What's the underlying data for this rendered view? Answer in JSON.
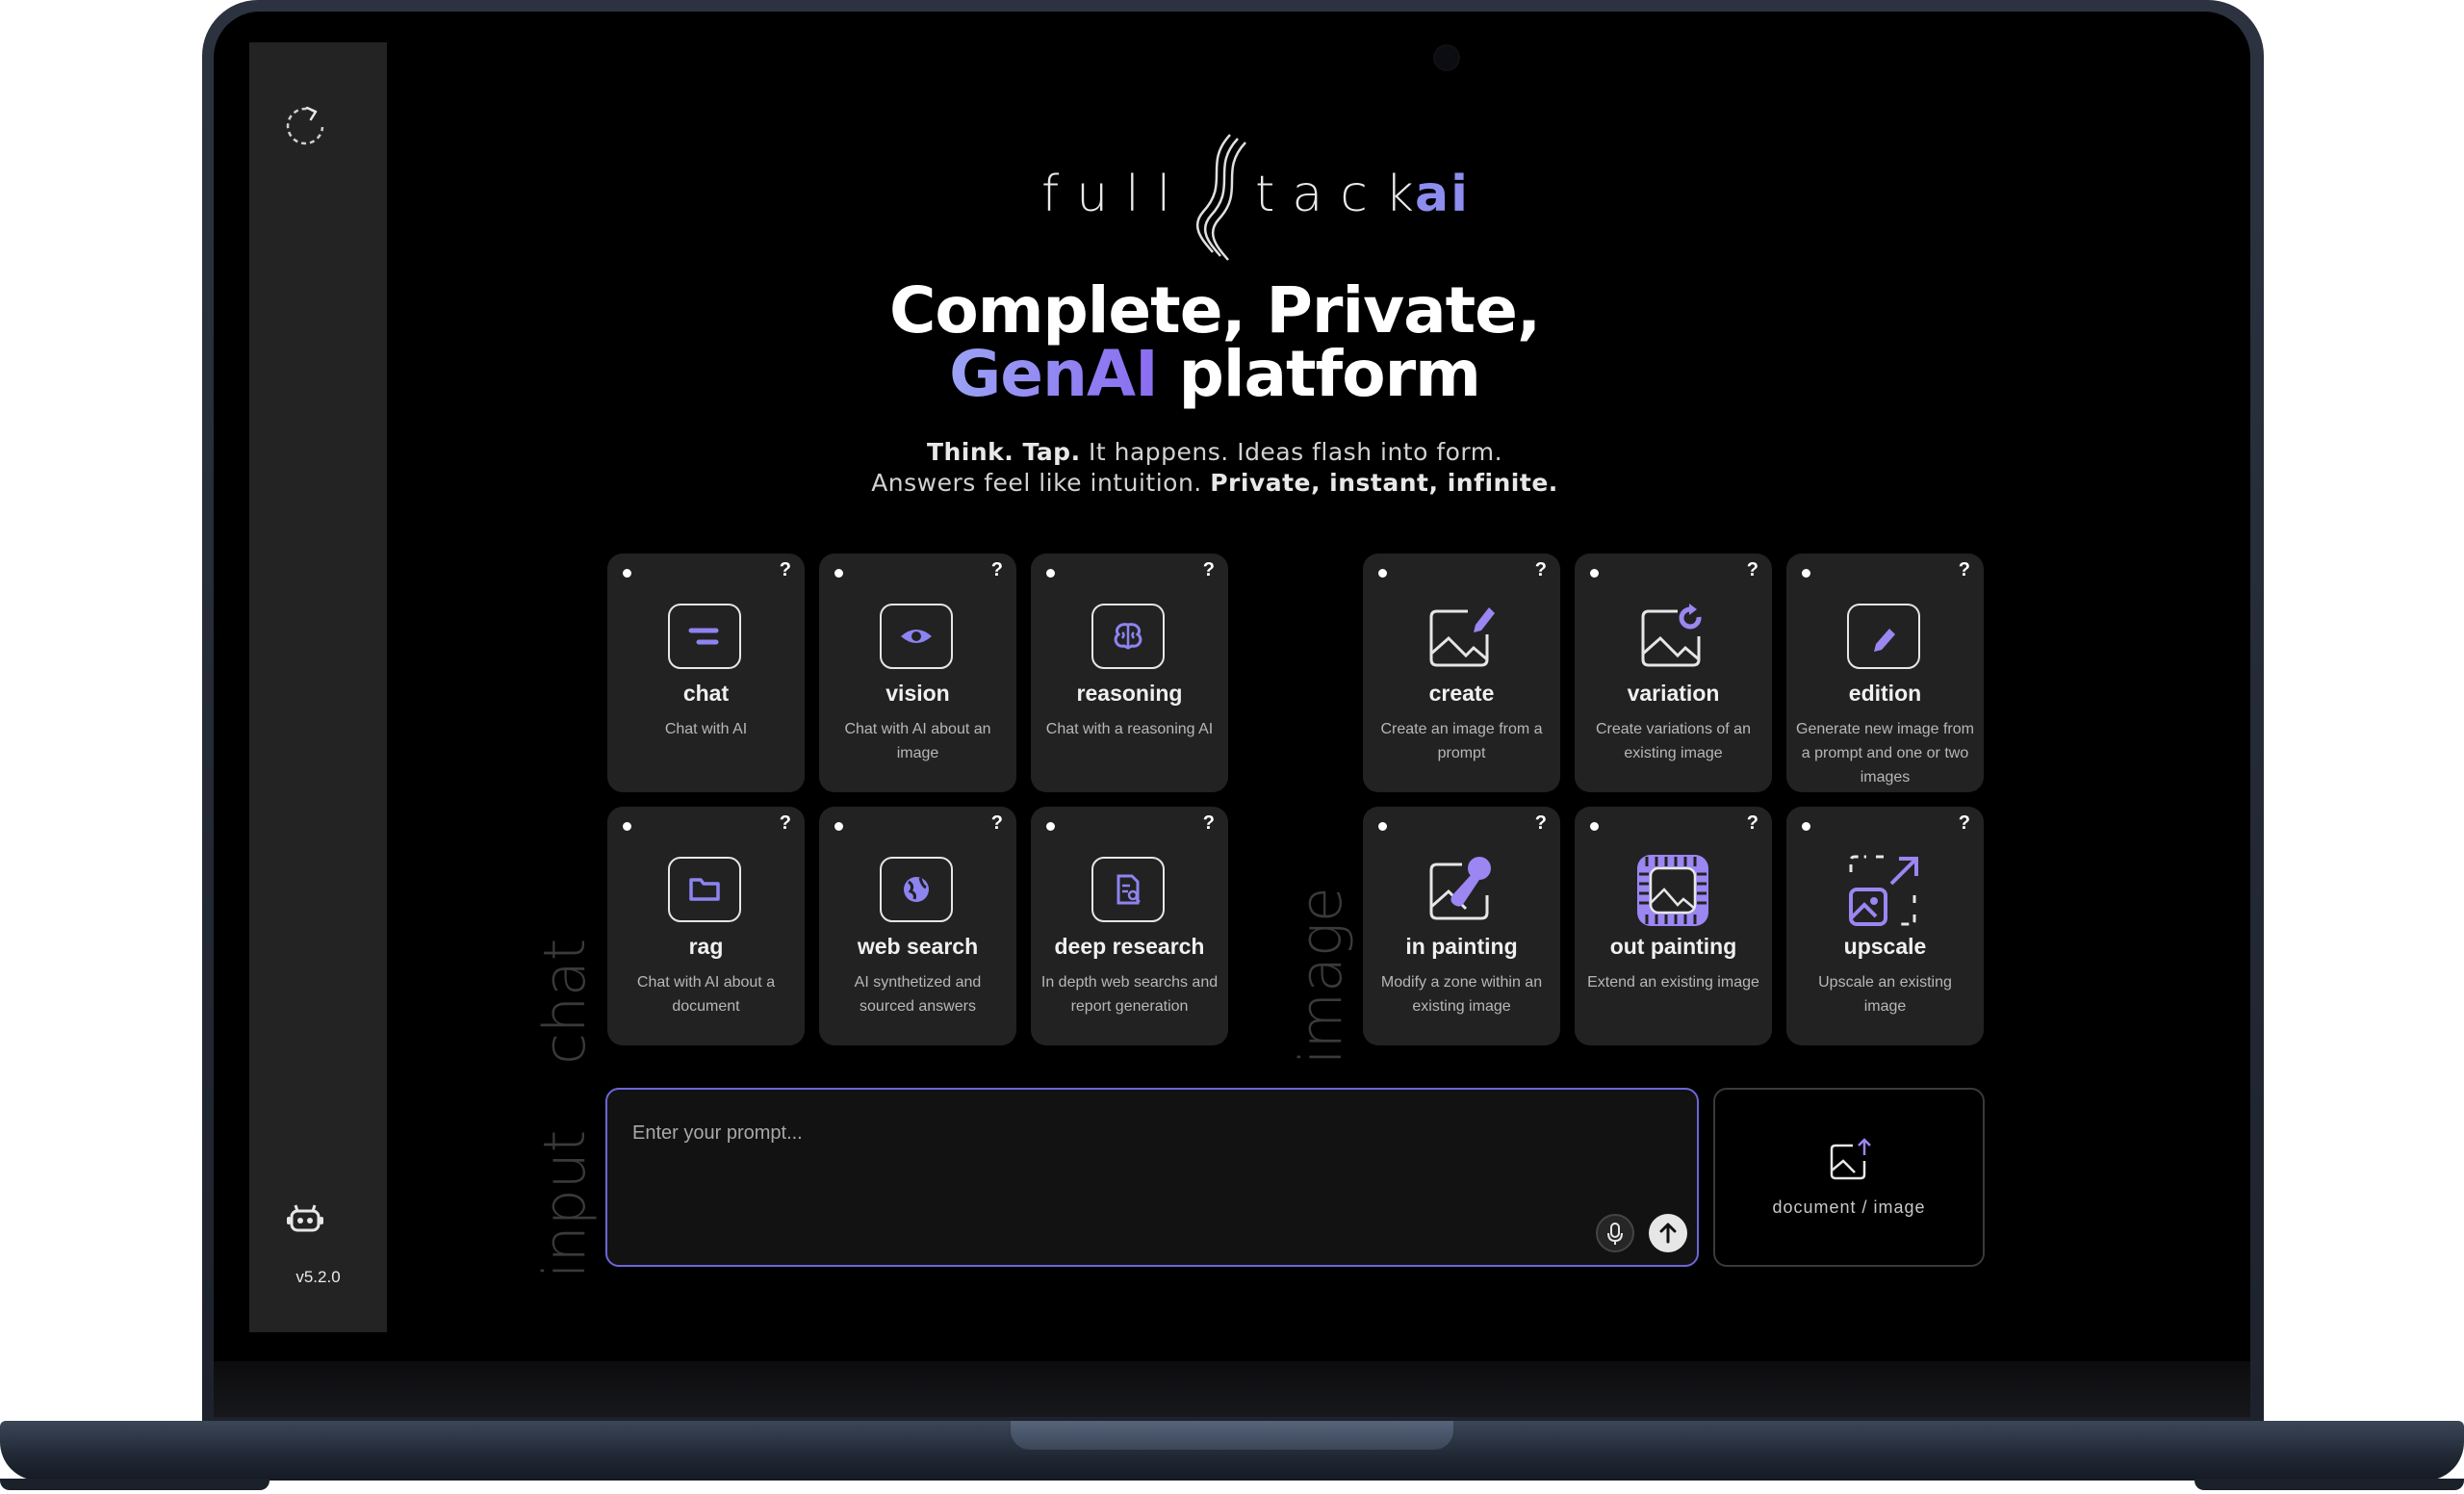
{
  "sidebar": {
    "version": "v5.2.0"
  },
  "logo": {
    "part1": "full",
    "part2": "tack",
    "ai": "ai"
  },
  "hero": {
    "line1": "Complete, Private,",
    "line2_accent": "GenAI",
    "line2_rest": " platform"
  },
  "subtitle": {
    "l1_bold": "Think. Tap.",
    "l1_rest": " It happens. Ideas flash into form.",
    "l2_rest": "Answers feel like intuition. ",
    "l2_bold": "Private, instant, infinite."
  },
  "sections": {
    "chat": "chat",
    "image": "image",
    "input": "input"
  },
  "help_symbol": "?",
  "chat_cards": [
    {
      "name": "chat",
      "desc": "Chat with AI",
      "icon": "chat-icon"
    },
    {
      "name": "vision",
      "desc": "Chat with AI about an image",
      "icon": "eye-icon"
    },
    {
      "name": "reasoning",
      "desc": "Chat with a reasoning AI",
      "icon": "brain-icon"
    },
    {
      "name": "rag",
      "desc": "Chat with AI about a document",
      "icon": "folder-icon"
    },
    {
      "name": "web search",
      "desc": "AI synthetized and sourced answers",
      "icon": "globe-icon"
    },
    {
      "name": "deep research",
      "desc": "In depth web searchs and report generation",
      "icon": "document-search-icon"
    }
  ],
  "image_cards": [
    {
      "name": "create",
      "desc": "Create an image from a prompt",
      "icon": "image-pencil-icon"
    },
    {
      "name": "variation",
      "desc": "Create variations of an existing image",
      "icon": "image-refresh-icon"
    },
    {
      "name": "edition",
      "desc": "Generate new image from a prompt and one or two images",
      "icon": "edit-icon"
    },
    {
      "name": "in painting",
      "desc": "Modify a zone within an existing image",
      "icon": "brush-icon"
    },
    {
      "name": "out painting",
      "desc": "Extend an existing image",
      "icon": "image-expand-icon"
    },
    {
      "name": "upscale",
      "desc": "Upscale an existing image",
      "icon": "upscale-icon"
    }
  ],
  "prompt": {
    "placeholder": "Enter your prompt..."
  },
  "upload": {
    "label": "document / image"
  },
  "colors": {
    "accent": "#8a6cf0",
    "accent_light": "#9aa3f5",
    "card_bg": "#222222",
    "sidebar_bg": "#232323"
  }
}
